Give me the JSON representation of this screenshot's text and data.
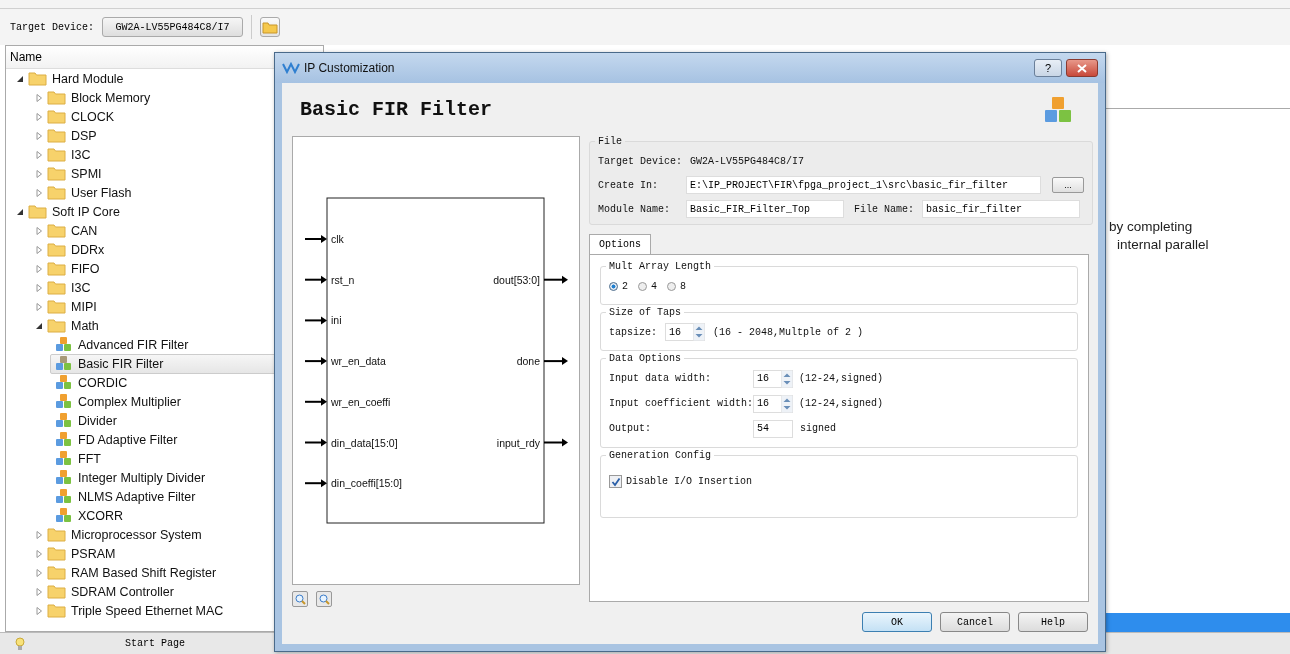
{
  "toolbar": {
    "target_device_label": "Target Device:",
    "target_device": "GW2A-LV55PG484C8/I7"
  },
  "tree": {
    "header": "Name",
    "items": [
      {
        "label": "Hard Module",
        "kind": "folder",
        "expanded": true,
        "children": [
          {
            "label": "Block Memory",
            "kind": "folder",
            "expanded": false
          },
          {
            "label": "CLOCK",
            "kind": "folder",
            "expanded": false
          },
          {
            "label": "DSP",
            "kind": "folder",
            "expanded": false
          },
          {
            "label": "I3C",
            "kind": "folder",
            "expanded": false
          },
          {
            "label": "SPMI",
            "kind": "folder",
            "expanded": false
          },
          {
            "label": "User Flash",
            "kind": "folder",
            "expanded": false
          }
        ]
      },
      {
        "label": "Soft IP Core",
        "kind": "folder",
        "expanded": true,
        "children": [
          {
            "label": "CAN",
            "kind": "folder",
            "expanded": false
          },
          {
            "label": "DDRx",
            "kind": "folder",
            "expanded": false
          },
          {
            "label": "FIFO",
            "kind": "folder",
            "expanded": false
          },
          {
            "label": "I3C",
            "kind": "folder",
            "expanded": false
          },
          {
            "label": "MIPI",
            "kind": "folder",
            "expanded": false
          },
          {
            "label": "Math",
            "kind": "folder",
            "expanded": true,
            "children": [
              {
                "label": "Advanced FIR Filter",
                "kind": "ip",
                "selected": false
              },
              {
                "label": "Basic FIR Filter",
                "kind": "ip",
                "selected": true
              },
              {
                "label": "CORDIC",
                "kind": "ip",
                "selected": false
              },
              {
                "label": "Complex Multiplier",
                "kind": "ip",
                "selected": false
              },
              {
                "label": "Divider",
                "kind": "ip",
                "selected": false
              },
              {
                "label": "FD Adaptive Filter",
                "kind": "ip",
                "selected": false
              },
              {
                "label": "FFT",
                "kind": "ip",
                "selected": false
              },
              {
                "label": "Integer Multiply Divider",
                "kind": "ip",
                "selected": false
              },
              {
                "label": "NLMS Adaptive Filter",
                "kind": "ip",
                "selected": false
              },
              {
                "label": "XCORR",
                "kind": "ip",
                "selected": false
              }
            ]
          },
          {
            "label": "Microprocessor System",
            "kind": "folder",
            "expanded": false
          },
          {
            "label": "PSRAM",
            "kind": "folder",
            "expanded": false
          },
          {
            "label": "RAM Based Shift Register",
            "kind": "folder",
            "expanded": false
          },
          {
            "label": "SDRAM Controller",
            "kind": "folder",
            "expanded": false
          },
          {
            "label": "Triple Speed Ethernet MAC",
            "kind": "folder",
            "expanded": false
          }
        ]
      }
    ]
  },
  "background_text": [
    "by completing",
    "internal parallel"
  ],
  "status_bar": {
    "tab": "Start Page"
  },
  "dialog": {
    "title": "IP Customization",
    "help": "?",
    "heading": "Basic FIR Filter",
    "diagram": {
      "inputs": [
        "clk",
        "rst_n",
        "ini",
        "wr_en_data",
        "wr_en_coeffi",
        "din_data[15:0]",
        "din_coeffi[15:0]"
      ],
      "outputs": [
        "dout[53:0]",
        "done",
        "input_rdy"
      ]
    },
    "file": {
      "title": "File",
      "target_device_label": "Target Device:",
      "target_device": "GW2A-LV55PG484C8/I7",
      "create_in_label": "Create In:",
      "create_in": "E:\\IP_PROJECT\\FIR\\fpga_project_1\\src\\basic_fir_filter",
      "browse": "...",
      "module_name_label": "Module Name:",
      "module_name": "Basic_FIR_Filter_Top",
      "file_name_label": "File Name:",
      "file_name": "basic_fir_filter"
    },
    "tabs": [
      {
        "label": "Options",
        "selected": true
      }
    ],
    "mult_array": {
      "title": "Mult Array Length",
      "options": [
        {
          "label": "2",
          "selected": true
        },
        {
          "label": "4",
          "selected": false
        },
        {
          "label": "8",
          "selected": false
        }
      ]
    },
    "taps": {
      "title": "Size of Taps",
      "label": "tapsize:",
      "value": "16",
      "hint": "(16 - 2048,Multple of 2 )"
    },
    "data_options": {
      "title": "Data Options",
      "rows": [
        {
          "label": "Input data width:",
          "value": "16",
          "hint": "(12-24,signed)",
          "kind": "spin"
        },
        {
          "label": "Input coefficient width:",
          "value": "16",
          "hint": "(12-24,signed)",
          "kind": "spin"
        },
        {
          "label": "Output:",
          "value": "54",
          "hint": "signed",
          "kind": "plain"
        }
      ]
    },
    "generation": {
      "title": "Generation Config",
      "label": "Disable I/O Insertion",
      "checked": true
    },
    "buttons": [
      {
        "label": "OK",
        "default": true
      },
      {
        "label": "Cancel",
        "default": false
      },
      {
        "label": "Help",
        "default": false
      }
    ]
  }
}
